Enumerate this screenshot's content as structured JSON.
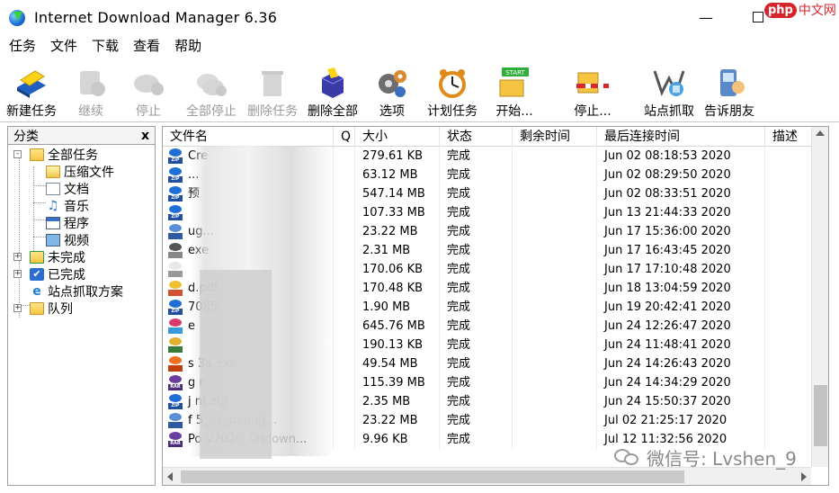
{
  "window": {
    "title": "Internet Download Manager 6.36",
    "minimize_glyph": "—",
    "close_glyph": "✕"
  },
  "menu": [
    "任务",
    "文件",
    "下载",
    "查看",
    "帮助"
  ],
  "toolbar": [
    {
      "label": "新建任务",
      "icon": "new-task-icon",
      "enabled": true
    },
    {
      "label": "继续",
      "icon": "resume-icon",
      "enabled": false
    },
    {
      "label": "停止",
      "icon": "stop-icon",
      "enabled": false
    },
    {
      "label": "全部停止",
      "icon": "stop-all-icon",
      "enabled": false
    },
    {
      "label": "删除任务",
      "icon": "delete-task-icon",
      "enabled": false
    },
    {
      "label": "删除全部",
      "icon": "delete-all-icon",
      "enabled": true
    },
    {
      "label": "选项",
      "icon": "options-gear-icon",
      "enabled": true
    },
    {
      "label": "计划任务",
      "icon": "scheduler-clock-icon",
      "enabled": true
    },
    {
      "label": "开始...",
      "icon": "start-queue-icon",
      "enabled": true,
      "icon_text": "START"
    },
    {
      "label": "停止...",
      "icon": "stop-queue-icon",
      "enabled": true
    },
    {
      "label": "站点抓取",
      "icon": "site-grabber-icon",
      "enabled": true
    },
    {
      "label": "告诉朋友",
      "icon": "tell-friend-icon",
      "enabled": true
    }
  ],
  "categories": {
    "title": "分类",
    "close": "x",
    "items": [
      {
        "label": "全部任务",
        "icon": "folder-open-icon",
        "expander": "-"
      },
      {
        "label": "压缩文件",
        "icon": "archive-folder-icon"
      },
      {
        "label": "文档",
        "icon": "document-icon"
      },
      {
        "label": "音乐",
        "icon": "music-note-icon"
      },
      {
        "label": "程序",
        "icon": "program-window-icon"
      },
      {
        "label": "视频",
        "icon": "video-icon"
      },
      {
        "label": "未完成",
        "icon": "unfinished-folder-icon",
        "expander": "+"
      },
      {
        "label": "已完成",
        "icon": "finished-folder-icon",
        "expander": "+"
      },
      {
        "label": "站点抓取方案",
        "icon": "ie-globe-icon"
      },
      {
        "label": "队列",
        "icon": "queue-folder-icon",
        "expander": "+"
      }
    ]
  },
  "file_list": {
    "columns": [
      "文件名",
      "Q",
      "大小",
      "状态",
      "剩余时间",
      "最后连接时间",
      "描述"
    ],
    "rows": [
      {
        "name": "Cre",
        "size": "279.61  KB",
        "status": "完成",
        "last": "Jun 02 08:18:53 2020",
        "type": "zip"
      },
      {
        "name": "...",
        "size": "63.12  MB",
        "status": "完成",
        "last": "Jun 02 08:29:50 2020",
        "type": "zip"
      },
      {
        "name": "预",
        "size": "547.14  MB",
        "status": "完成",
        "last": "Jun 02 08:33:51 2020",
        "type": "zip"
      },
      {
        "name": "",
        "size": "107.33  MB",
        "status": "完成",
        "last": "Jun 13 21:44:33 2020",
        "type": "zip"
      },
      {
        "name": "ug...",
        "size": "23.22  MB",
        "status": "完成",
        "last": "Jun 17 15:36:00 2020",
        "type": "exe"
      },
      {
        "name": "exe",
        "size": "2.31  MB",
        "status": "完成",
        "last": "Jun 17 16:43:45 2020",
        "type": "printer"
      },
      {
        "name": "",
        "size": "170.06  KB",
        "status": "完成",
        "last": "Jun 17 17:10:48 2020",
        "type": "doc"
      },
      {
        "name": "d.pdf",
        "size": "170.48  KB",
        "status": "完成",
        "last": "Jun 18 13:04:59 2020",
        "type": "pdf"
      },
      {
        "name": "7085...",
        "size": "1.90  MB",
        "status": "完成",
        "last": "Jun 19 20:42:41 2020",
        "type": "zip"
      },
      {
        "name": "e",
        "size": "645.76  MB",
        "status": "完成",
        "last": "Jun 24 12:26:47 2020",
        "type": "media"
      },
      {
        "name": "",
        "size": "190.13  KB",
        "status": "完成",
        "last": "Jun 24 11:48:41 2020",
        "type": "install"
      },
      {
        "name": "s           3a.exe",
        "size": "49.54  MB",
        "status": "完成",
        "last": "Jun 24 14:26:43 2020",
        "type": "setup"
      },
      {
        "name": "g              r",
        "size": "115.39  MB",
        "status": "完成",
        "last": "Jun 24 14:34:29 2020",
        "type": "rar"
      },
      {
        "name": "j              nt.zip",
        "size": "2.35  MB",
        "status": "完成",
        "last": "Jun 24 15:50:37 2020",
        "type": "zip"
      },
      {
        "name": "f              5_ax_debug...",
        "size": "23.22  MB",
        "status": "完成",
        "last": "Jul 02 21:25:17 2020",
        "type": "exe"
      },
      {
        "name": "Po          V2020_LHdown...",
        "size": "9.96  KB",
        "status": "完成",
        "last": "Jul 12 11:32:56 2020",
        "type": "rar"
      }
    ]
  },
  "watermarks": {
    "php_badge": "php",
    "php_site": "中文网",
    "wechat": "微信号: Lvshen_9"
  },
  "colors": {
    "zip": "#1565c0",
    "rar": "#6a3fa0",
    "accent_red": "#d6262c"
  }
}
